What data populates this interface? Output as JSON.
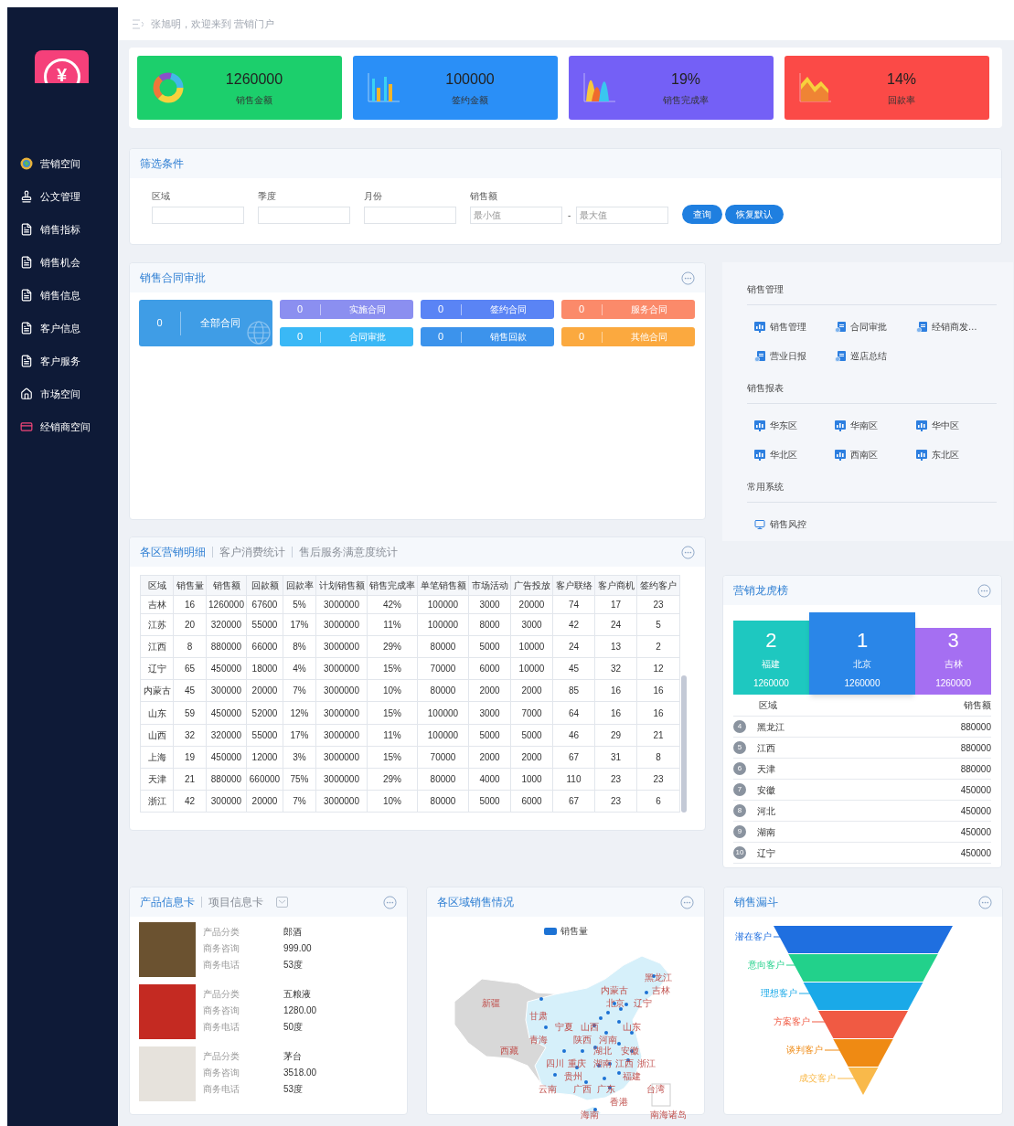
{
  "sidebar": {
    "logo": {
      "symbol": "¥"
    },
    "items": [
      {
        "kind": "globe",
        "label": "营销空间"
      },
      {
        "kind": "stamp",
        "label": "公文管理"
      },
      {
        "kind": "doc",
        "label": "销售指标"
      },
      {
        "kind": "doc",
        "label": "销售机会"
      },
      {
        "kind": "doc",
        "label": "销售信息"
      },
      {
        "kind": "doc",
        "label": "客户信息"
      },
      {
        "kind": "doc",
        "label": "客户服务"
      },
      {
        "kind": "house",
        "label": "市场空间"
      },
      {
        "kind": "card",
        "label": "经销商空间"
      }
    ]
  },
  "header": {
    "welcome": "张旭明，欢迎来到 营销门户"
  },
  "stats": [
    {
      "value": "1260000",
      "label": "销售金额",
      "color": "#1ccf6c",
      "kind": "donut"
    },
    {
      "value": "100000",
      "label": "签约金额",
      "color": "#2a8ff7",
      "kind": "bars"
    },
    {
      "value": "19%",
      "label": "销售完成率",
      "color": "#7460f6",
      "kind": "peaks"
    },
    {
      "value": "14%",
      "label": "回款率",
      "color": "#fb4a47",
      "kind": "area"
    }
  ],
  "filter": {
    "title": "筛选条件",
    "fields": [
      {
        "label": "区域"
      },
      {
        "label": "季度"
      },
      {
        "label": "月份"
      }
    ],
    "range": {
      "label": "销售额",
      "min_placeholder": "最小值",
      "separator": "-",
      "max_placeholder": "最大值"
    },
    "buttons": [
      "查询",
      "恢复默认"
    ]
  },
  "contracts": {
    "title": "销售合同审批",
    "main": {
      "count": "0",
      "label": "全部合同"
    },
    "items": [
      {
        "count": "0",
        "label": "实施合同",
        "color": "#8b8ff0"
      },
      {
        "count": "0",
        "label": "签约合同",
        "color": "#5a84f5"
      },
      {
        "count": "0",
        "label": "服务合同",
        "color": "#fb8a6a"
      },
      {
        "count": "0",
        "label": "合同审批",
        "color": "#3ab8f6"
      },
      {
        "count": "0",
        "label": "销售回款",
        "color": "#3c93ec"
      },
      {
        "count": "0",
        "label": "其他合同",
        "color": "#fba93f"
      }
    ]
  },
  "menu": {
    "sections": [
      {
        "title": "销售管理",
        "items": [
          {
            "kind": "chart",
            "label": "销售管理"
          },
          {
            "kind": "doc",
            "label": "合同审批"
          },
          {
            "kind": "doc",
            "label": "经销商发…"
          },
          {
            "kind": "doc",
            "label": "营业日报"
          },
          {
            "kind": "doc",
            "label": "巡店总结"
          }
        ]
      },
      {
        "title": "销售报表",
        "items": [
          {
            "kind": "chart",
            "label": "华东区"
          },
          {
            "kind": "chart",
            "label": "华南区"
          },
          {
            "kind": "chart",
            "label": "华中区"
          },
          {
            "kind": "chart",
            "label": "华北区"
          },
          {
            "kind": "chart",
            "label": "西南区"
          },
          {
            "kind": "chart",
            "label": "东北区"
          }
        ]
      },
      {
        "title": "常用系统",
        "items": [
          {
            "kind": "monitor",
            "label": "销售风控"
          }
        ]
      }
    ]
  },
  "details": {
    "tabs": [
      {
        "label": "各区营销明细",
        "selected": true
      },
      {
        "label": "客户消费统计",
        "selected": false
      },
      {
        "label": "售后服务满意度统计",
        "selected": false
      }
    ],
    "columns": [
      "区域",
      "销售量",
      "销售额",
      "回款额",
      "回款率",
      "计划销售额",
      "销售完成率",
      "单笔销售额",
      "市场活动",
      "广告投放",
      "客户联络",
      "客户商机",
      "签约客户"
    ],
    "rows": [
      [
        "吉林",
        "16",
        "1260000",
        "67600",
        "5%",
        "3000000",
        "42%",
        "100000",
        "3000",
        "20000",
        "74",
        "17",
        "23"
      ],
      [
        "江苏",
        "20",
        "320000",
        "55000",
        "17%",
        "3000000",
        "11%",
        "100000",
        "8000",
        "3000",
        "42",
        "24",
        "5"
      ],
      [
        "江西",
        "8",
        "880000",
        "66000",
        "8%",
        "3000000",
        "29%",
        "80000",
        "5000",
        "10000",
        "24",
        "13",
        "2"
      ],
      [
        "辽宁",
        "65",
        "450000",
        "18000",
        "4%",
        "3000000",
        "15%",
        "70000",
        "6000",
        "10000",
        "45",
        "32",
        "12"
      ],
      [
        "内蒙古",
        "45",
        "300000",
        "20000",
        "7%",
        "3000000",
        "10%",
        "80000",
        "2000",
        "2000",
        "85",
        "16",
        "16"
      ],
      [
        "山东",
        "59",
        "450000",
        "52000",
        "12%",
        "3000000",
        "15%",
        "100000",
        "3000",
        "7000",
        "64",
        "16",
        "16"
      ],
      [
        "山西",
        "32",
        "320000",
        "55000",
        "17%",
        "3000000",
        "11%",
        "100000",
        "5000",
        "5000",
        "46",
        "29",
        "21"
      ],
      [
        "上海",
        "19",
        "450000",
        "12000",
        "3%",
        "3000000",
        "15%",
        "70000",
        "2000",
        "2000",
        "67",
        "31",
        "8"
      ],
      [
        "天津",
        "21",
        "880000",
        "660000",
        "75%",
        "3000000",
        "29%",
        "80000",
        "4000",
        "1000",
        "110",
        "23",
        "23"
      ],
      [
        "浙江",
        "42",
        "300000",
        "20000",
        "7%",
        "3000000",
        "10%",
        "80000",
        "5000",
        "6000",
        "67",
        "23",
        "6"
      ]
    ]
  },
  "ranking": {
    "title": "营销龙虎榜",
    "podium": [
      {
        "rank": "2",
        "name": "福建",
        "value": "1260000",
        "color": "#1ec8c0"
      },
      {
        "rank": "1",
        "name": "北京",
        "value": "1260000",
        "color": "#2a86e8"
      },
      {
        "rank": "3",
        "name": "吉林",
        "value": "1260000",
        "color": "#a56ff2"
      }
    ],
    "columns": [
      "区域",
      "销售额"
    ],
    "rows": [
      {
        "rank": "4",
        "name": "黑龙江",
        "value": "880000"
      },
      {
        "rank": "5",
        "name": "江西",
        "value": "880000"
      },
      {
        "rank": "6",
        "name": "天津",
        "value": "880000"
      },
      {
        "rank": "7",
        "name": "安徽",
        "value": "450000"
      },
      {
        "rank": "8",
        "name": "河北",
        "value": "450000"
      },
      {
        "rank": "9",
        "name": "湖南",
        "value": "450000"
      },
      {
        "rank": "10",
        "name": "辽宁",
        "value": "450000"
      }
    ]
  },
  "products": {
    "tabs": [
      {
        "label": "产品信息卡",
        "selected": true
      },
      {
        "label": "项目信息卡",
        "selected": false
      }
    ],
    "items": [
      {
        "fields": [
          {
            "label": "产品分类",
            "value": "郎酒"
          },
          {
            "label": "商务咨询",
            "value": "999.00"
          },
          {
            "label": "商务电话",
            "value": "53度"
          }
        ]
      },
      {
        "fields": [
          {
            "label": "产品分类",
            "value": "五粮液"
          },
          {
            "label": "商务咨询",
            "value": "1280.00"
          },
          {
            "label": "商务电话",
            "value": "50度"
          }
        ]
      },
      {
        "fields": [
          {
            "label": "产品分类",
            "value": "茅台"
          },
          {
            "label": "商务咨询",
            "value": "3518.00"
          },
          {
            "label": "商务电话",
            "value": "53度"
          }
        ]
      }
    ]
  },
  "map": {
    "title": "各区域销售情况",
    "legend": "销售量",
    "labels": [
      "黑龙江",
      "内蒙古",
      "吉林",
      "新疆",
      "北京",
      "辽宁",
      "甘肃",
      "宁夏",
      "山西",
      "山东",
      "青海",
      "陕西",
      "河南",
      "西藏",
      "湖北",
      "安徽",
      "四川",
      "重庆",
      "湖南",
      "江西",
      "浙江",
      "贵州",
      "福建",
      "云南",
      "广西",
      "广东",
      "台湾",
      "香港",
      "海南",
      "南海诸岛"
    ]
  },
  "funnel": {
    "title": "销售漏斗",
    "stages": [
      {
        "label": "潜在客户",
        "color": "#1f6fe0"
      },
      {
        "label": "意向客户",
        "color": "#22d18b"
      },
      {
        "label": "理想客户",
        "color": "#1aa9e8"
      },
      {
        "label": "方案客户",
        "color": "#f05a43"
      },
      {
        "label": "谈判客户",
        "color": "#ef8a13"
      },
      {
        "label": "成交客户",
        "color": "#f9b94a"
      }
    ]
  }
}
